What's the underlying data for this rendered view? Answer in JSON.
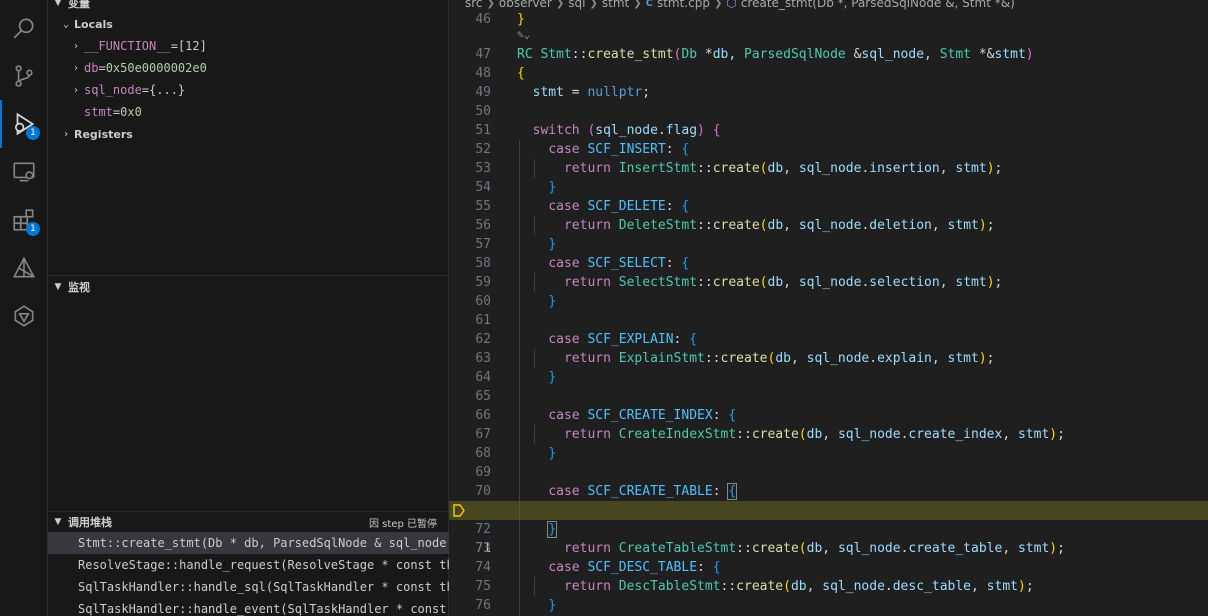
{
  "activity": {
    "debug_badge": "1",
    "extensions_badge": "1"
  },
  "variables": {
    "section_label": "变量",
    "locals_label": "Locals",
    "items": [
      {
        "name": "__FUNCTION__",
        "eq": " = ",
        "value": "[12]"
      },
      {
        "name": "db",
        "eq": " = ",
        "value": "0x50e0000002e0"
      },
      {
        "name": "sql_node",
        "eq": " = ",
        "value": "{...}"
      },
      {
        "name": "stmt",
        "eq": " = ",
        "value": "0x0"
      }
    ],
    "registers_label": "Registers"
  },
  "watch": {
    "section_label": "监视"
  },
  "callstack": {
    "section_label": "调用堆栈",
    "paused_label": "因 step 已暂停",
    "frames": [
      "Stmt::create_stmt(Db * db, ParsedSqlNode & sql_node,",
      "ResolveStage::handle_request(ResolveStage * const th",
      "SqlTaskHandler::handle_sql(SqlTaskHandler * const th",
      "SqlTaskHandler::handle_event(SqlTaskHandler * const"
    ]
  },
  "breadcrumb": {
    "parts": [
      "src",
      "observer",
      "sql",
      "stmt"
    ],
    "file_icon": "C",
    "file": "stmt.cpp",
    "symbol": "create_stmt(Db *, ParsedSqlNode &, Stmt *&)"
  },
  "editor": {
    "current_line": "71",
    "line_numbers": [
      "46",
      "47",
      "48",
      "49",
      "50",
      "51",
      "52",
      "53",
      "54",
      "55",
      "56",
      "57",
      "58",
      "59",
      "60",
      "61",
      "62",
      "63",
      "64",
      "65",
      "66",
      "67",
      "68",
      "69",
      "70",
      "71",
      "72",
      "73",
      "74",
      "75",
      "76"
    ]
  },
  "colors": {
    "accent": "#0078d4",
    "current_line_highlight": "#666620",
    "breakpoint_arrow": "#ffcc00"
  }
}
